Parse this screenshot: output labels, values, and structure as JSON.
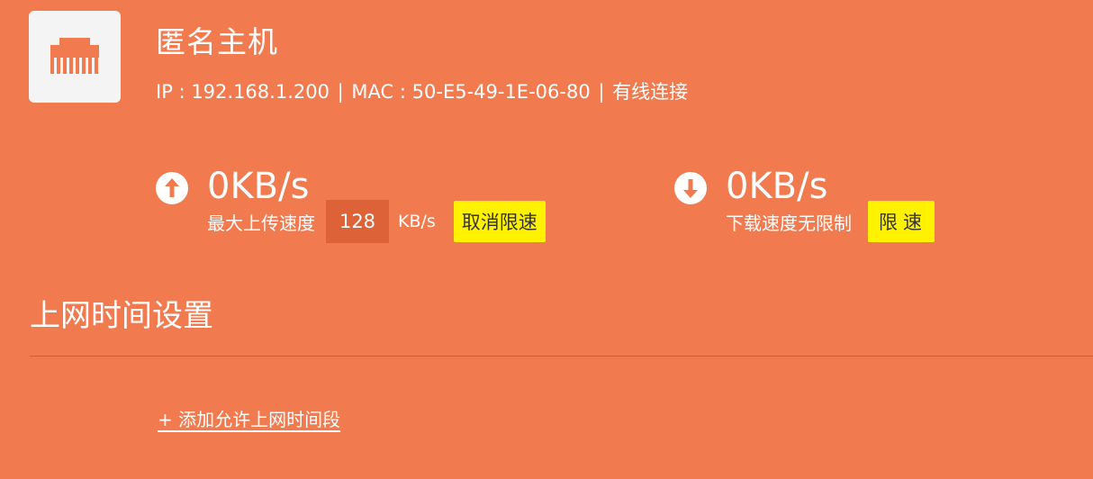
{
  "device": {
    "icon": "ethernet-port-icon",
    "name": "匿名主机",
    "ip_label": "IP",
    "ip": "192.168.1.200",
    "mac_label": "MAC",
    "mac": "50-E5-49-1E-06-80",
    "connection": "有线连接"
  },
  "upload": {
    "icon": "arrow-up-circle-icon",
    "speed": "0KB/s",
    "label": "最大上传速度",
    "limit_value": "128",
    "unit": "KB/s",
    "button_label": "取消限速"
  },
  "download": {
    "icon": "arrow-down-circle-icon",
    "speed": "0KB/s",
    "label": "下载速度无限制",
    "button_label": "限速"
  },
  "schedule": {
    "title": "上网时间设置",
    "add_link": "+ 添加允许上网时间段"
  },
  "colors": {
    "background": "#F27A4F",
    "input_bg": "#DD6238",
    "button_bg": "#FFF200",
    "icon_accent": "#F27A4F"
  }
}
